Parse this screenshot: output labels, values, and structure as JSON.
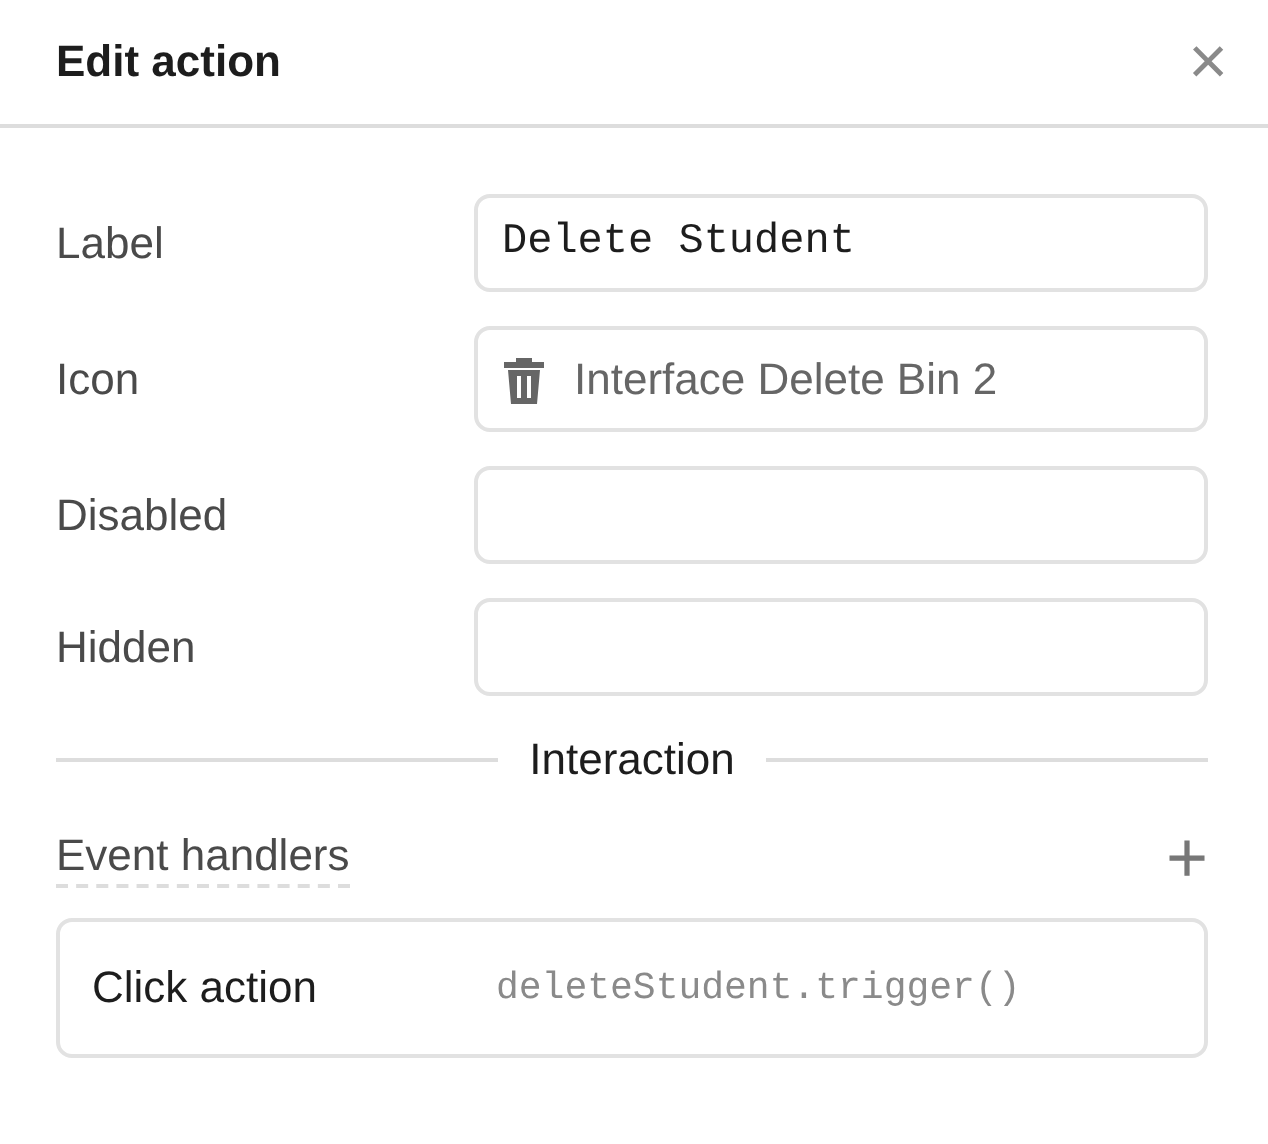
{
  "panel": {
    "title": "Edit action",
    "close": "×"
  },
  "fields": [
    {
      "label": "Label",
      "kind": "code",
      "value": "Delete Student"
    },
    {
      "label": "Icon",
      "kind": "icon",
      "value": "Interface Delete Bin 2"
    },
    {
      "label": "Disabled",
      "kind": "code"
    },
    {
      "label": "Hidden",
      "kind": "code"
    }
  ],
  "section": {
    "title": "Interaction"
  },
  "event_handlers": {
    "title": "Event handlers",
    "add": "+",
    "items": [
      {
        "event": "Click action",
        "action": "deleteStudent.trigger()"
      }
    ]
  }
}
